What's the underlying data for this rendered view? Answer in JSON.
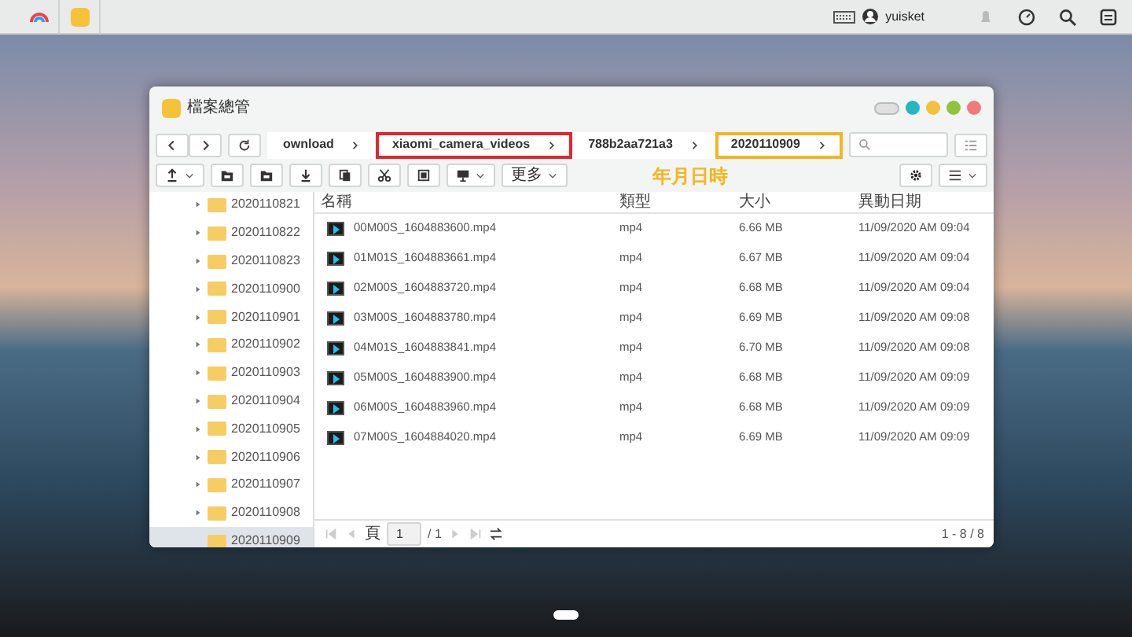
{
  "taskbar": {
    "user": "yuisket"
  },
  "window": {
    "title": "檔案總管"
  },
  "breadcrumb": [
    {
      "label": "ownload"
    },
    {
      "label": "xiaomi_camera_videos",
      "color": "#e8232a"
    },
    {
      "label": "788b2aa721a3"
    },
    {
      "label": "2020110909",
      "color": "#f5b51e"
    }
  ],
  "annotation": "年月日時",
  "toolbar": {
    "more": "更多"
  },
  "tree": [
    {
      "label": "2020110821",
      "selected": false
    },
    {
      "label": "2020110822",
      "selected": false
    },
    {
      "label": "2020110823",
      "selected": false
    },
    {
      "label": "2020110900",
      "selected": false
    },
    {
      "label": "2020110901",
      "selected": false
    },
    {
      "label": "2020110902",
      "selected": false
    },
    {
      "label": "2020110903",
      "selected": false
    },
    {
      "label": "2020110904",
      "selected": false
    },
    {
      "label": "2020110905",
      "selected": false
    },
    {
      "label": "2020110906",
      "selected": false
    },
    {
      "label": "2020110907",
      "selected": false
    },
    {
      "label": "2020110908",
      "selected": false
    },
    {
      "label": "2020110909",
      "selected": true
    }
  ],
  "table": {
    "columns": [
      "名稱",
      "類型",
      "大小",
      "異動日期"
    ],
    "rows": [
      [
        "00M00S_1604883600.mp4",
        "mp4",
        "6.66 MB",
        "11/09/2020 AM 09:04"
      ],
      [
        "01M01S_1604883661.mp4",
        "mp4",
        "6.67 MB",
        "11/09/2020 AM 09:04"
      ],
      [
        "02M00S_1604883720.mp4",
        "mp4",
        "6.68 MB",
        "11/09/2020 AM 09:04"
      ],
      [
        "03M00S_1604883780.mp4",
        "mp4",
        "6.69 MB",
        "11/09/2020 AM 09:08"
      ],
      [
        "04M01S_1604883841.mp4",
        "mp4",
        "6.70 MB",
        "11/09/2020 AM 09:08"
      ],
      [
        "05M00S_1604883900.mp4",
        "mp4",
        "6.68 MB",
        "11/09/2020 AM 09:09"
      ],
      [
        "06M00S_1604883960.mp4",
        "mp4",
        "6.68 MB",
        "11/09/2020 AM 09:09"
      ],
      [
        "07M00S_1604884020.mp4",
        "mp4",
        "6.69 MB",
        "11/09/2020 AM 09:09"
      ]
    ]
  },
  "pager": {
    "page_label": "頁",
    "page": "1",
    "total": "/ 1",
    "range": "1 - 8 / 8"
  }
}
